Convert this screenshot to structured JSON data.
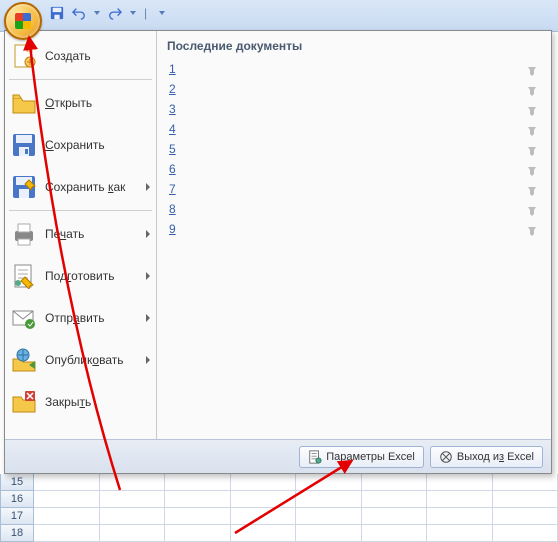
{
  "qat": {
    "save": "save",
    "undo": "undo",
    "redo": "redo"
  },
  "menu": {
    "items": [
      {
        "label": "Создать",
        "icon": "new-doc",
        "arrow": false
      },
      {
        "label": "Открыть",
        "icon": "open-folder",
        "arrow": false,
        "hk": 0
      },
      {
        "label": "Сохранить",
        "icon": "save-disk",
        "arrow": false,
        "hk": 0
      },
      {
        "label": "Сохранить как",
        "icon": "save-as",
        "arrow": true,
        "hk": 10
      },
      {
        "label": "Печать",
        "icon": "print",
        "arrow": true,
        "hk": 2
      },
      {
        "label": "Подготовить",
        "icon": "prepare",
        "arrow": true,
        "hk": 3
      },
      {
        "label": "Отправить",
        "icon": "send",
        "arrow": true,
        "hk": 4
      },
      {
        "label": "Опубликовать",
        "icon": "publish",
        "arrow": true,
        "hk": 7
      },
      {
        "label": "Закрыть",
        "icon": "close-doc",
        "arrow": false,
        "hk": 5
      }
    ]
  },
  "recent": {
    "heading": "Последние документы",
    "items": [
      "1",
      "2",
      "3",
      "4",
      "5",
      "6",
      "7",
      "8",
      "9"
    ]
  },
  "footer": {
    "options_label": "Параметры Excel",
    "exit_label": "Выход из Excel"
  },
  "sheet": {
    "rows": [
      "15",
      "16",
      "17",
      "18"
    ]
  }
}
